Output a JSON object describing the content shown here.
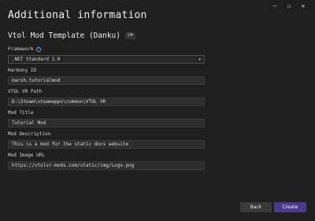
{
  "window": {
    "minimize": "—",
    "maximize": "☐",
    "close": "✕"
  },
  "header": {
    "title": "Additional information",
    "template_name": "Vtol Mod Template (Danku)",
    "language_tag": "C#"
  },
  "fields": {
    "framework": {
      "label": "Framework",
      "value": ".NET Standard 2.0"
    },
    "harmony_id": {
      "label": "Harmony ID",
      "value": "marsh.tutorialmod"
    },
    "vtol_path": {
      "label": "VTOL VR Path",
      "value": "D:\\Steam\\steamapps\\common\\VTOL VR"
    },
    "mod_title": {
      "label": "Mod Title",
      "value": "Tutorial Mod"
    },
    "mod_description": {
      "label": "Mod Description",
      "value": "This is a mod for the static docs website"
    },
    "mod_image_url": {
      "label": "Mod Image URL",
      "value": "https://vtolvr-mods.com/static/img/Logo.png"
    }
  },
  "buttons": {
    "back": "Back",
    "create": "Create"
  },
  "icons": {
    "info": "i",
    "chevron": "▾"
  }
}
